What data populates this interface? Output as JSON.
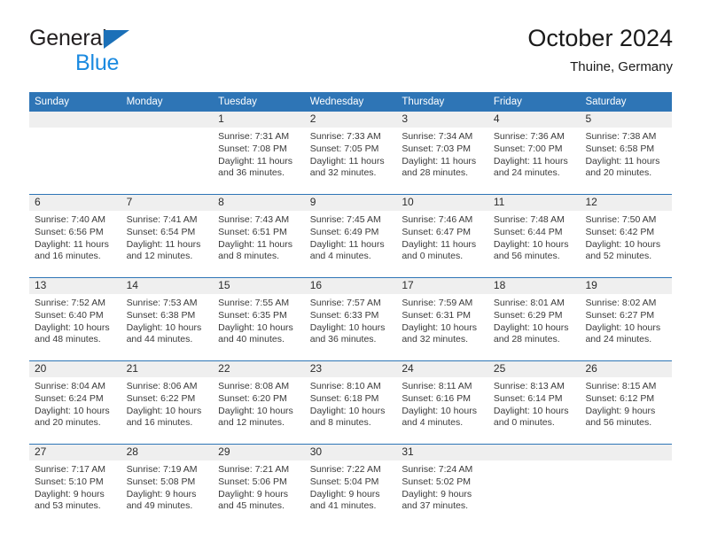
{
  "brand": {
    "name_part1": "General",
    "name_part2": "Blue",
    "triangle_color": "#1b70b8",
    "blue_color": "#1b8ae0"
  },
  "header": {
    "title": "October 2024",
    "subtitle": "Thuine, Germany",
    "header_bg": "#2e75b6",
    "band_bg": "#efefef"
  },
  "weekdays": [
    "Sunday",
    "Monday",
    "Tuesday",
    "Wednesday",
    "Thursday",
    "Friday",
    "Saturday"
  ],
  "weeks": [
    [
      {
        "day": "",
        "sunrise": "",
        "sunset": "",
        "daylight_line1": "",
        "daylight_line2": ""
      },
      {
        "day": "",
        "sunrise": "",
        "sunset": "",
        "daylight_line1": "",
        "daylight_line2": ""
      },
      {
        "day": "1",
        "sunrise": "Sunrise: 7:31 AM",
        "sunset": "Sunset: 7:08 PM",
        "daylight_line1": "Daylight: 11 hours",
        "daylight_line2": "and 36 minutes."
      },
      {
        "day": "2",
        "sunrise": "Sunrise: 7:33 AM",
        "sunset": "Sunset: 7:05 PM",
        "daylight_line1": "Daylight: 11 hours",
        "daylight_line2": "and 32 minutes."
      },
      {
        "day": "3",
        "sunrise": "Sunrise: 7:34 AM",
        "sunset": "Sunset: 7:03 PM",
        "daylight_line1": "Daylight: 11 hours",
        "daylight_line2": "and 28 minutes."
      },
      {
        "day": "4",
        "sunrise": "Sunrise: 7:36 AM",
        "sunset": "Sunset: 7:00 PM",
        "daylight_line1": "Daylight: 11 hours",
        "daylight_line2": "and 24 minutes."
      },
      {
        "day": "5",
        "sunrise": "Sunrise: 7:38 AM",
        "sunset": "Sunset: 6:58 PM",
        "daylight_line1": "Daylight: 11 hours",
        "daylight_line2": "and 20 minutes."
      }
    ],
    [
      {
        "day": "6",
        "sunrise": "Sunrise: 7:40 AM",
        "sunset": "Sunset: 6:56 PM",
        "daylight_line1": "Daylight: 11 hours",
        "daylight_line2": "and 16 minutes."
      },
      {
        "day": "7",
        "sunrise": "Sunrise: 7:41 AM",
        "sunset": "Sunset: 6:54 PM",
        "daylight_line1": "Daylight: 11 hours",
        "daylight_line2": "and 12 minutes."
      },
      {
        "day": "8",
        "sunrise": "Sunrise: 7:43 AM",
        "sunset": "Sunset: 6:51 PM",
        "daylight_line1": "Daylight: 11 hours",
        "daylight_line2": "and 8 minutes."
      },
      {
        "day": "9",
        "sunrise": "Sunrise: 7:45 AM",
        "sunset": "Sunset: 6:49 PM",
        "daylight_line1": "Daylight: 11 hours",
        "daylight_line2": "and 4 minutes."
      },
      {
        "day": "10",
        "sunrise": "Sunrise: 7:46 AM",
        "sunset": "Sunset: 6:47 PM",
        "daylight_line1": "Daylight: 11 hours",
        "daylight_line2": "and 0 minutes."
      },
      {
        "day": "11",
        "sunrise": "Sunrise: 7:48 AM",
        "sunset": "Sunset: 6:44 PM",
        "daylight_line1": "Daylight: 10 hours",
        "daylight_line2": "and 56 minutes."
      },
      {
        "day": "12",
        "sunrise": "Sunrise: 7:50 AM",
        "sunset": "Sunset: 6:42 PM",
        "daylight_line1": "Daylight: 10 hours",
        "daylight_line2": "and 52 minutes."
      }
    ],
    [
      {
        "day": "13",
        "sunrise": "Sunrise: 7:52 AM",
        "sunset": "Sunset: 6:40 PM",
        "daylight_line1": "Daylight: 10 hours",
        "daylight_line2": "and 48 minutes."
      },
      {
        "day": "14",
        "sunrise": "Sunrise: 7:53 AM",
        "sunset": "Sunset: 6:38 PM",
        "daylight_line1": "Daylight: 10 hours",
        "daylight_line2": "and 44 minutes."
      },
      {
        "day": "15",
        "sunrise": "Sunrise: 7:55 AM",
        "sunset": "Sunset: 6:35 PM",
        "daylight_line1": "Daylight: 10 hours",
        "daylight_line2": "and 40 minutes."
      },
      {
        "day": "16",
        "sunrise": "Sunrise: 7:57 AM",
        "sunset": "Sunset: 6:33 PM",
        "daylight_line1": "Daylight: 10 hours",
        "daylight_line2": "and 36 minutes."
      },
      {
        "day": "17",
        "sunrise": "Sunrise: 7:59 AM",
        "sunset": "Sunset: 6:31 PM",
        "daylight_line1": "Daylight: 10 hours",
        "daylight_line2": "and 32 minutes."
      },
      {
        "day": "18",
        "sunrise": "Sunrise: 8:01 AM",
        "sunset": "Sunset: 6:29 PM",
        "daylight_line1": "Daylight: 10 hours",
        "daylight_line2": "and 28 minutes."
      },
      {
        "day": "19",
        "sunrise": "Sunrise: 8:02 AM",
        "sunset": "Sunset: 6:27 PM",
        "daylight_line1": "Daylight: 10 hours",
        "daylight_line2": "and 24 minutes."
      }
    ],
    [
      {
        "day": "20",
        "sunrise": "Sunrise: 8:04 AM",
        "sunset": "Sunset: 6:24 PM",
        "daylight_line1": "Daylight: 10 hours",
        "daylight_line2": "and 20 minutes."
      },
      {
        "day": "21",
        "sunrise": "Sunrise: 8:06 AM",
        "sunset": "Sunset: 6:22 PM",
        "daylight_line1": "Daylight: 10 hours",
        "daylight_line2": "and 16 minutes."
      },
      {
        "day": "22",
        "sunrise": "Sunrise: 8:08 AM",
        "sunset": "Sunset: 6:20 PM",
        "daylight_line1": "Daylight: 10 hours",
        "daylight_line2": "and 12 minutes."
      },
      {
        "day": "23",
        "sunrise": "Sunrise: 8:10 AM",
        "sunset": "Sunset: 6:18 PM",
        "daylight_line1": "Daylight: 10 hours",
        "daylight_line2": "and 8 minutes."
      },
      {
        "day": "24",
        "sunrise": "Sunrise: 8:11 AM",
        "sunset": "Sunset: 6:16 PM",
        "daylight_line1": "Daylight: 10 hours",
        "daylight_line2": "and 4 minutes."
      },
      {
        "day": "25",
        "sunrise": "Sunrise: 8:13 AM",
        "sunset": "Sunset: 6:14 PM",
        "daylight_line1": "Daylight: 10 hours",
        "daylight_line2": "and 0 minutes."
      },
      {
        "day": "26",
        "sunrise": "Sunrise: 8:15 AM",
        "sunset": "Sunset: 6:12 PM",
        "daylight_line1": "Daylight: 9 hours",
        "daylight_line2": "and 56 minutes."
      }
    ],
    [
      {
        "day": "27",
        "sunrise": "Sunrise: 7:17 AM",
        "sunset": "Sunset: 5:10 PM",
        "daylight_line1": "Daylight: 9 hours",
        "daylight_line2": "and 53 minutes."
      },
      {
        "day": "28",
        "sunrise": "Sunrise: 7:19 AM",
        "sunset": "Sunset: 5:08 PM",
        "daylight_line1": "Daylight: 9 hours",
        "daylight_line2": "and 49 minutes."
      },
      {
        "day": "29",
        "sunrise": "Sunrise: 7:21 AM",
        "sunset": "Sunset: 5:06 PM",
        "daylight_line1": "Daylight: 9 hours",
        "daylight_line2": "and 45 minutes."
      },
      {
        "day": "30",
        "sunrise": "Sunrise: 7:22 AM",
        "sunset": "Sunset: 5:04 PM",
        "daylight_line1": "Daylight: 9 hours",
        "daylight_line2": "and 41 minutes."
      },
      {
        "day": "31",
        "sunrise": "Sunrise: 7:24 AM",
        "sunset": "Sunset: 5:02 PM",
        "daylight_line1": "Daylight: 9 hours",
        "daylight_line2": "and 37 minutes."
      },
      {
        "day": "",
        "sunrise": "",
        "sunset": "",
        "daylight_line1": "",
        "daylight_line2": ""
      },
      {
        "day": "",
        "sunrise": "",
        "sunset": "",
        "daylight_line1": "",
        "daylight_line2": ""
      }
    ]
  ]
}
